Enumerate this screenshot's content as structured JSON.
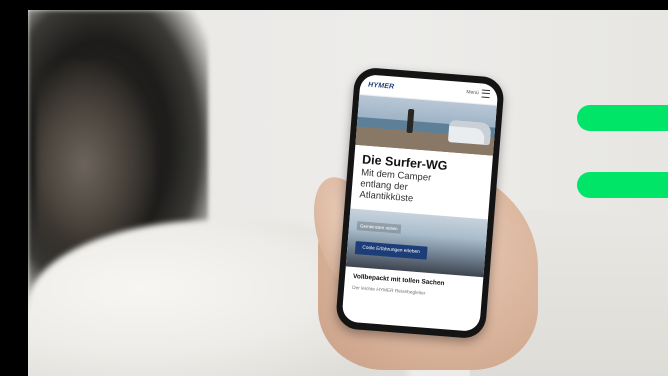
{
  "phone": {
    "brand": "HYMER",
    "menu_label": "Menü",
    "article": {
      "title": "Die Surfer-WG",
      "subtitle": "Mit dem Camper\nentlang der\nAtlantikküste"
    },
    "promo": {
      "label": "Gemeinsam reisen",
      "cta": "Coole Erfahrungen erleben"
    },
    "section": {
      "title": "Vollbepackt mit tollen Sachen",
      "text": "Der leichte HYMER Reisebegleiter"
    }
  },
  "colors": {
    "accent_green": "#00e468",
    "brand_blue": "#1d3d78"
  }
}
